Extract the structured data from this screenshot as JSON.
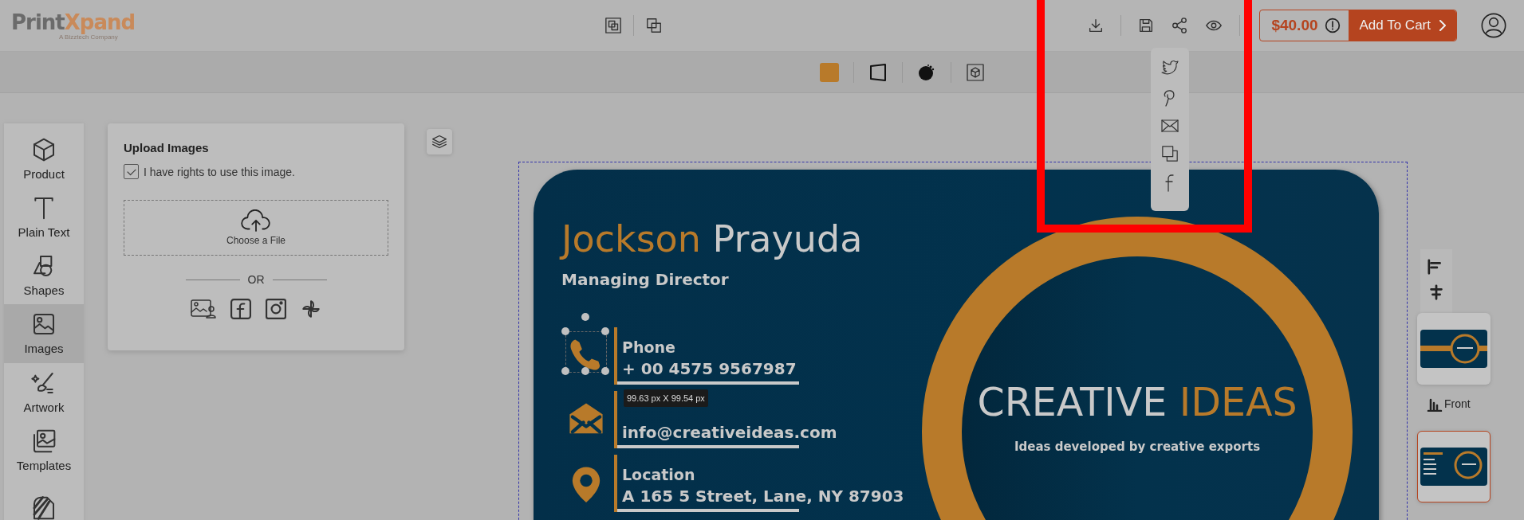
{
  "header": {
    "logo": {
      "word": "Print",
      "accent": "Xpand",
      "tagline": "A Bizztech Company"
    },
    "price": "$40.00",
    "cart_button": "Add To Cart"
  },
  "sidebar": {
    "items": [
      {
        "label": "Product",
        "selected": false
      },
      {
        "label": "Plain Text",
        "selected": false
      },
      {
        "label": "Shapes",
        "selected": false
      },
      {
        "label": "Images",
        "selected": true
      },
      {
        "label": "Artwork",
        "selected": false
      },
      {
        "label": "Templates",
        "selected": false
      },
      {
        "selected": false
      }
    ]
  },
  "upload_panel": {
    "title": "Upload Images",
    "rights_checkbox": {
      "label": "I have rights to use this image.",
      "checked": true
    },
    "dropzone": {
      "label": "Choose a File"
    },
    "divider": "OR"
  },
  "card": {
    "first_name": "Jockson",
    "last_name": "Prayuda",
    "job_title": "Managing Director",
    "contacts": [
      {
        "label": "Phone",
        "value": "+ 00 4575 9567987",
        "selected": true
      },
      {
        "value": "info@creativeideas.com",
        "selected": false
      },
      {
        "label": "Location",
        "value": "A 165 5 Street, Lane, NY 87903",
        "selected": false
      }
    ],
    "size_tooltip": "99.63 px X 99.54 px",
    "brand": {
      "word": "CREATIVE",
      "accent": "IDEAS",
      "tagline": "Ideas developed by creative exports"
    }
  },
  "pages": [
    {
      "label": "Front",
      "selected": false
    },
    {
      "selected": true
    }
  ]
}
